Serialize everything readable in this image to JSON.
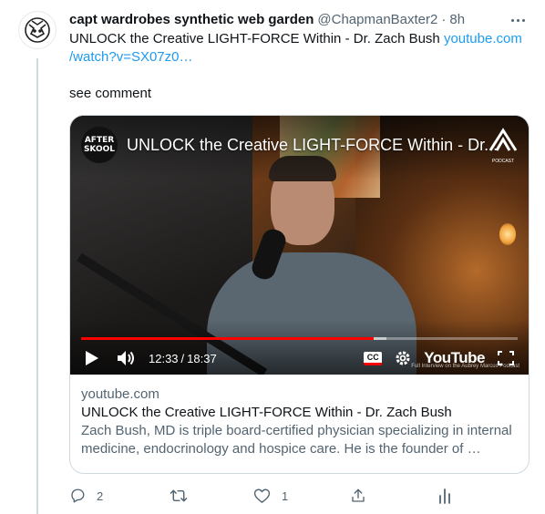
{
  "tweet": {
    "author_name": "capt wardrobes synthetic web garden",
    "author_handle": "@ChapmanBaxter2",
    "separator": "·",
    "time": "8h",
    "text_line1": "UNLOCK the Creative LIGHT-FORCE Within - Dr. Zach Bush ",
    "link_line1": "youtube.com",
    "link_line2": "/watch?v=SX07z0…",
    "text_line3": "see comment"
  },
  "card": {
    "video": {
      "channel_logo_line1": "AFTER",
      "channel_logo_line2": "SKOOL",
      "title": "UNLOCK the Creative LIGHT-FORCE Within - Dr...",
      "podcast_label": "PODCAST",
      "progress_fraction": 0.67,
      "buffer_fraction": 0.7,
      "current_time": "12:33",
      "time_separator": "/",
      "duration": "18:37",
      "cc_label": "CC",
      "youtube_label": "YouTube",
      "watermark": "Full Interview on the Aubrey Marcus Podcast",
      "progress_color": "#ff0000"
    },
    "domain": "youtube.com",
    "title": "UNLOCK the Creative LIGHT-FORCE Within - Dr. Zach Bush",
    "description_line1": "Zach Bush, MD is triple board-certified physician specializing in internal",
    "description_line2": "medicine, endocrinology and hospice care. He is the founder of …"
  },
  "actions": {
    "reply_count": "2",
    "retweet_count": "",
    "like_count": "1"
  },
  "colors": {
    "link": "#1d9bf0",
    "secondary_text": "#536471",
    "border": "#cfd9de"
  },
  "icons": [
    "robot-avatar-icon",
    "more-icon",
    "play-icon",
    "volume-icon",
    "cc-icon",
    "settings-icon",
    "fullscreen-icon",
    "reply-icon",
    "retweet-icon",
    "like-icon",
    "share-icon",
    "analytics-icon"
  ]
}
